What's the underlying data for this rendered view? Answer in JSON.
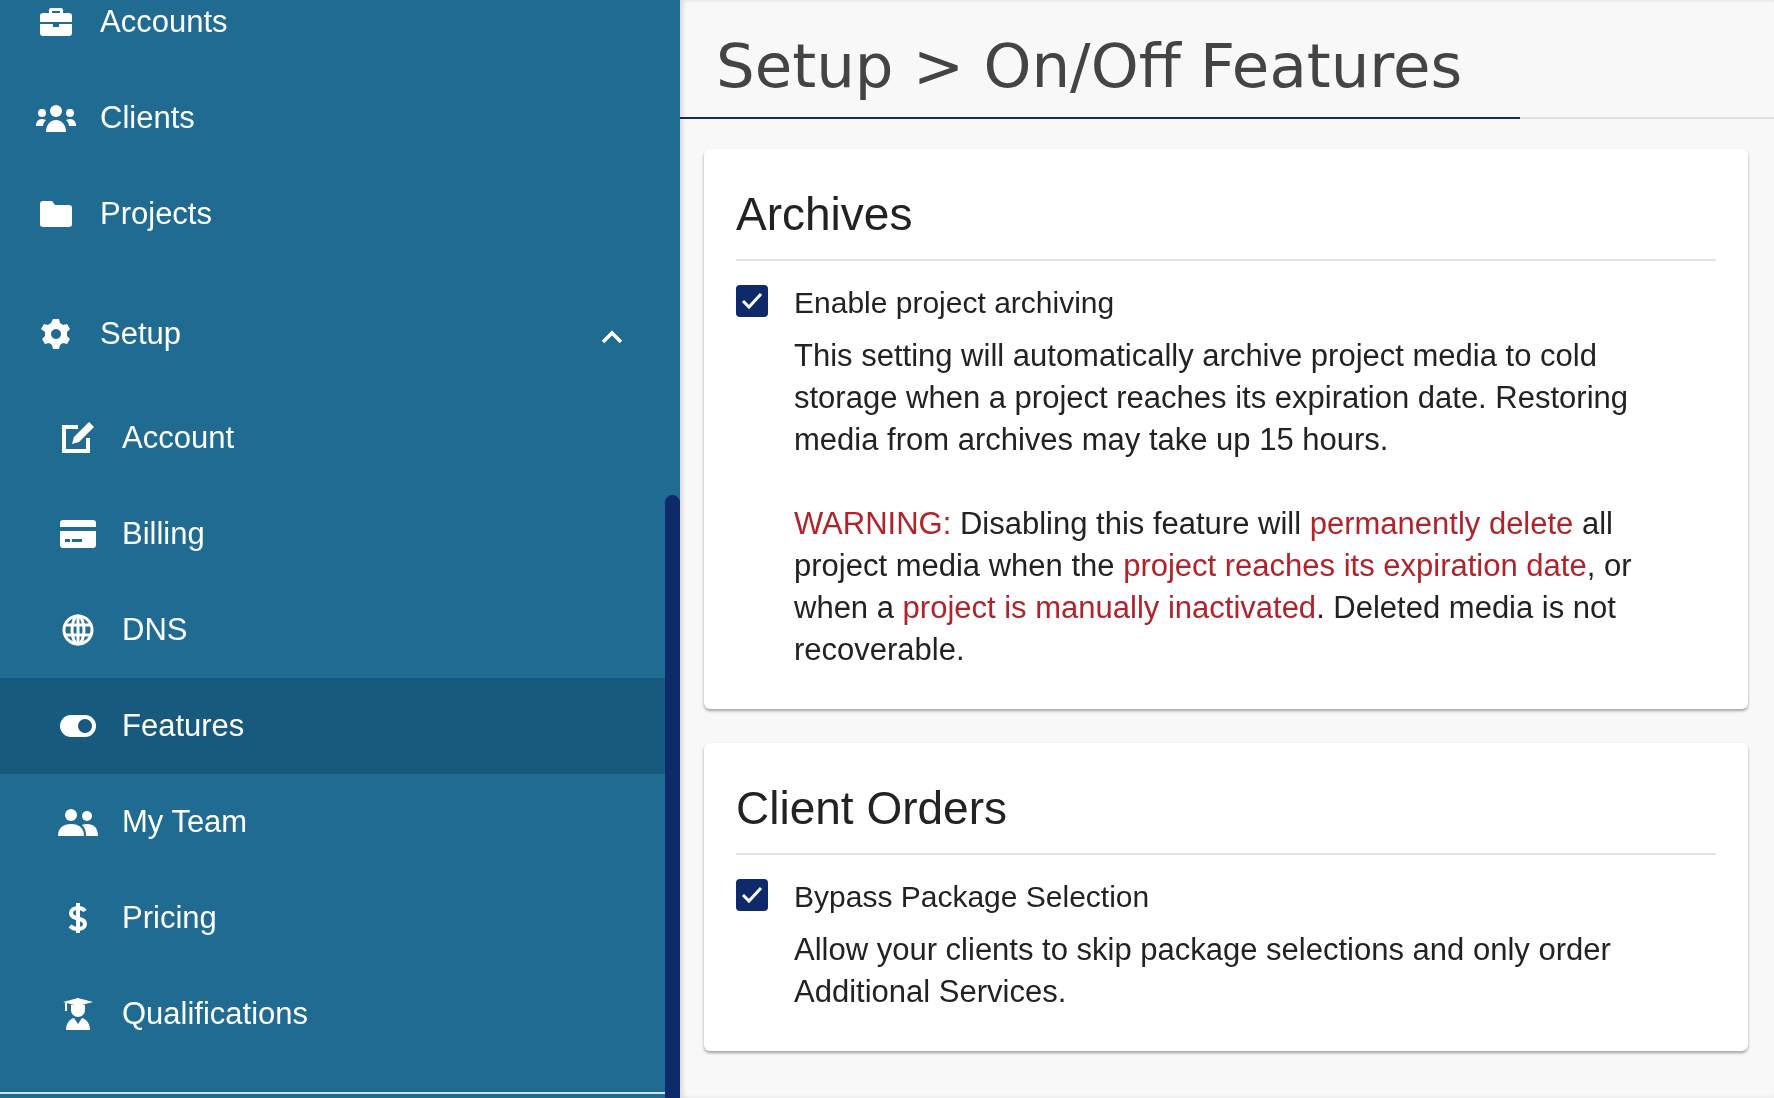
{
  "sidebar": {
    "items": [
      {
        "label": "Accounts",
        "selected": false
      },
      {
        "label": "Clients",
        "selected": false
      },
      {
        "label": "Projects",
        "selected": false
      },
      {
        "label": "Setup",
        "selected": false,
        "expanded": true,
        "children": [
          {
            "label": "Account",
            "selected": false
          },
          {
            "label": "Billing",
            "selected": false
          },
          {
            "label": "DNS",
            "selected": false
          },
          {
            "label": "Features",
            "selected": true
          },
          {
            "label": "My Team",
            "selected": false
          },
          {
            "label": "Pricing",
            "selected": false
          },
          {
            "label": "Qualifications",
            "selected": false
          }
        ]
      }
    ]
  },
  "page": {
    "title": "Setup > On/Off Features"
  },
  "sections": [
    {
      "title": "Archives",
      "options": [
        {
          "label": "Enable project archiving",
          "checked": true,
          "paragraphs": [
            [
              {
                "kind": "plain",
                "text": "This setting will automatically archive project media to cold storage when a project reaches its expiration date. Restoring media from archives may take up 15 hours."
              }
            ],
            [
              {
                "kind": "alert",
                "text": "WARNING:"
              },
              {
                "kind": "plain",
                "text": " Disabling this feature will "
              },
              {
                "kind": "alert",
                "text": "permanently delete"
              },
              {
                "kind": "plain",
                "text": " all project media when the "
              },
              {
                "kind": "alert",
                "text": "project reaches its expiration date"
              },
              {
                "kind": "plain",
                "text": ", or when a "
              },
              {
                "kind": "alert",
                "text": "project is manually inactivated"
              },
              {
                "kind": "plain",
                "text": ". Deleted media is not recoverable."
              }
            ]
          ]
        }
      ]
    },
    {
      "title": "Client Orders",
      "options": [
        {
          "label": "Bypass Package Selection",
          "checked": true,
          "paragraphs": [
            [
              {
                "kind": "plain",
                "text": "Allow your clients to skip package selections and only order Additional Services."
              }
            ]
          ]
        }
      ]
    }
  ]
}
